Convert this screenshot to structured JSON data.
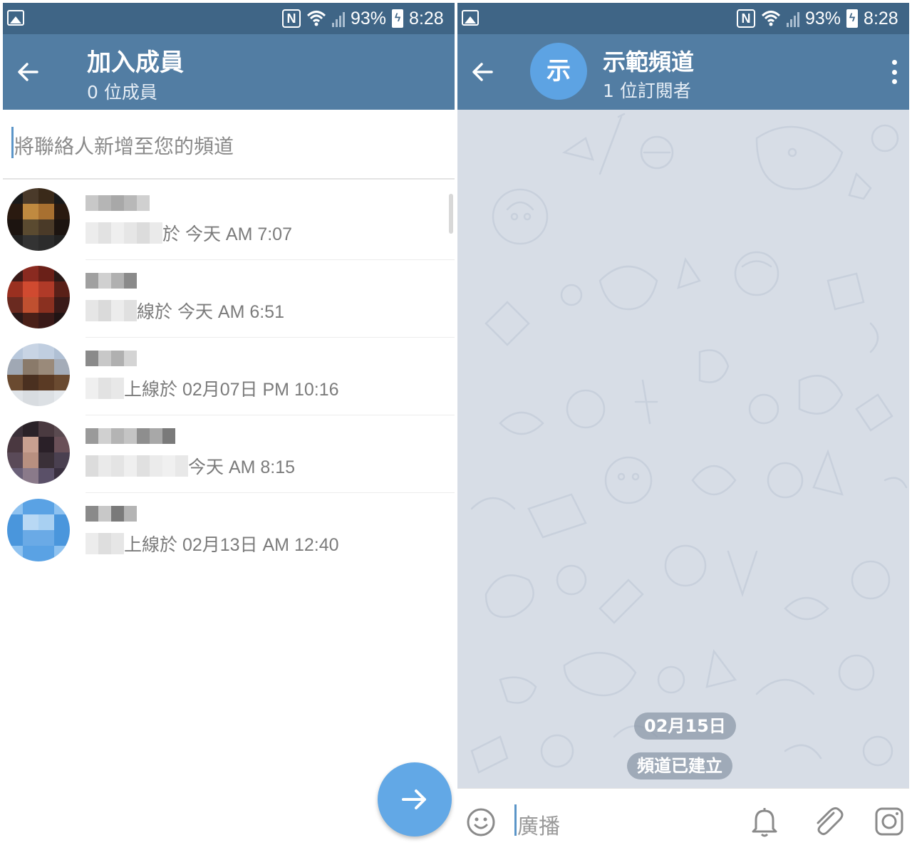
{
  "colors": {
    "statusbar": "#3f6586",
    "appbar": "#527da3",
    "accent": "#62a8e6",
    "chat_bg": "#d7dde6",
    "pill_bg": "#8c98a8"
  },
  "statusbar": {
    "battery": "93%",
    "time": "8:28"
  },
  "left": {
    "header": {
      "title": "加入成員",
      "subtitle": "0 位成員",
      "back_icon": "back-arrow-icon"
    },
    "search": {
      "placeholder": "將聯絡人新增至您的頻道"
    },
    "contacts": [
      {
        "status": "於 今天 AM 7:07"
      },
      {
        "status": "線於 今天 AM 6:51"
      },
      {
        "status": "上線於 02月07日 PM 10:16"
      },
      {
        "status": "今天 AM 8:15"
      },
      {
        "status": "上線於 02月13日 AM 12:40"
      }
    ],
    "fab_icon": "arrow-right-icon"
  },
  "right": {
    "header": {
      "avatar_letter": "示",
      "title": "示範頻道",
      "subtitle": "1 位訂閱者",
      "menu_icon": "more-vert-icon"
    },
    "messages": {
      "date": "02月15日",
      "service": "頻道已建立"
    },
    "input": {
      "placeholder": "廣播",
      "icons": [
        "emoji-icon",
        "bell-icon",
        "paperclip-icon",
        "camera-icon"
      ]
    }
  }
}
